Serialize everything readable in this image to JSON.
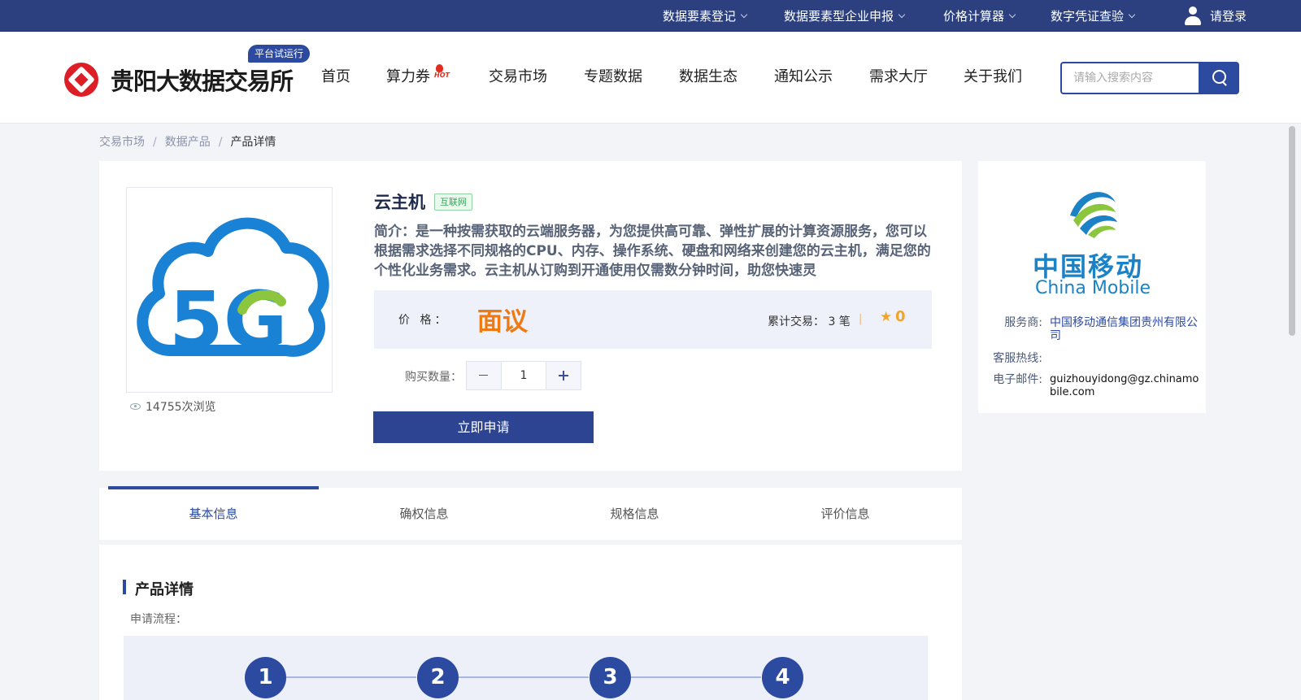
{
  "topbar": {
    "links": [
      "数据要素登记",
      "数据要素型企业申报",
      "价格计算器",
      "数字凭证查验"
    ],
    "login": "请登录"
  },
  "header": {
    "site_name": "贵阳大数据交易所",
    "trial_badge": "平台试运行",
    "nav": [
      "首页",
      "算力券",
      "交易市场",
      "专题数据",
      "数据生态",
      "通知公示",
      "需求大厅",
      "关于我们"
    ],
    "hot_label": "HOT",
    "search_placeholder": "请输入搜索内容",
    "accent_color": "#2c4aa0",
    "brand_red": "#dc1f26"
  },
  "breadcrumb": [
    "交易市场",
    "数据产品",
    "产品详情"
  ],
  "product": {
    "title": "云主机",
    "tag": "互联网",
    "image_text": "5G",
    "intro": "简介：是一种按需获取的云端服务器，为您提供高可靠、弹性扩展的计算资源服务，您可以根据需求选择不同规格的CPU、内存、操作系统、硬盘和网络来创建您的云主机，满足您的个性化业务需求。云主机从订购到开通使用仅需数分钟时间，助您快速灵",
    "price_label": "价 格：",
    "price_value": "面议",
    "trade_count": "累计交易： 3 笔",
    "rating": "0",
    "qty_label": "购买数量：",
    "qty_value": "1",
    "apply_label": "立即申请",
    "views": "14755次浏览",
    "price_color": "#f07a12"
  },
  "provider": {
    "logo_cn": "中国移动",
    "logo_en": "China Mobile",
    "service_label": "服务商:",
    "service_value": "中国移动通信集团贵州有限公司",
    "hotline_label": "客服热线:",
    "email_label": "电子邮件:",
    "email_value": "guizhouyidong@gz.chinamobile.com"
  },
  "tabs": [
    "基本信息",
    "确权信息",
    "规格信息",
    "评价信息"
  ],
  "detail": {
    "section_title": "产品详情",
    "flow_label": "申请流程：",
    "steps": [
      "1",
      "2",
      "3",
      "4"
    ]
  }
}
